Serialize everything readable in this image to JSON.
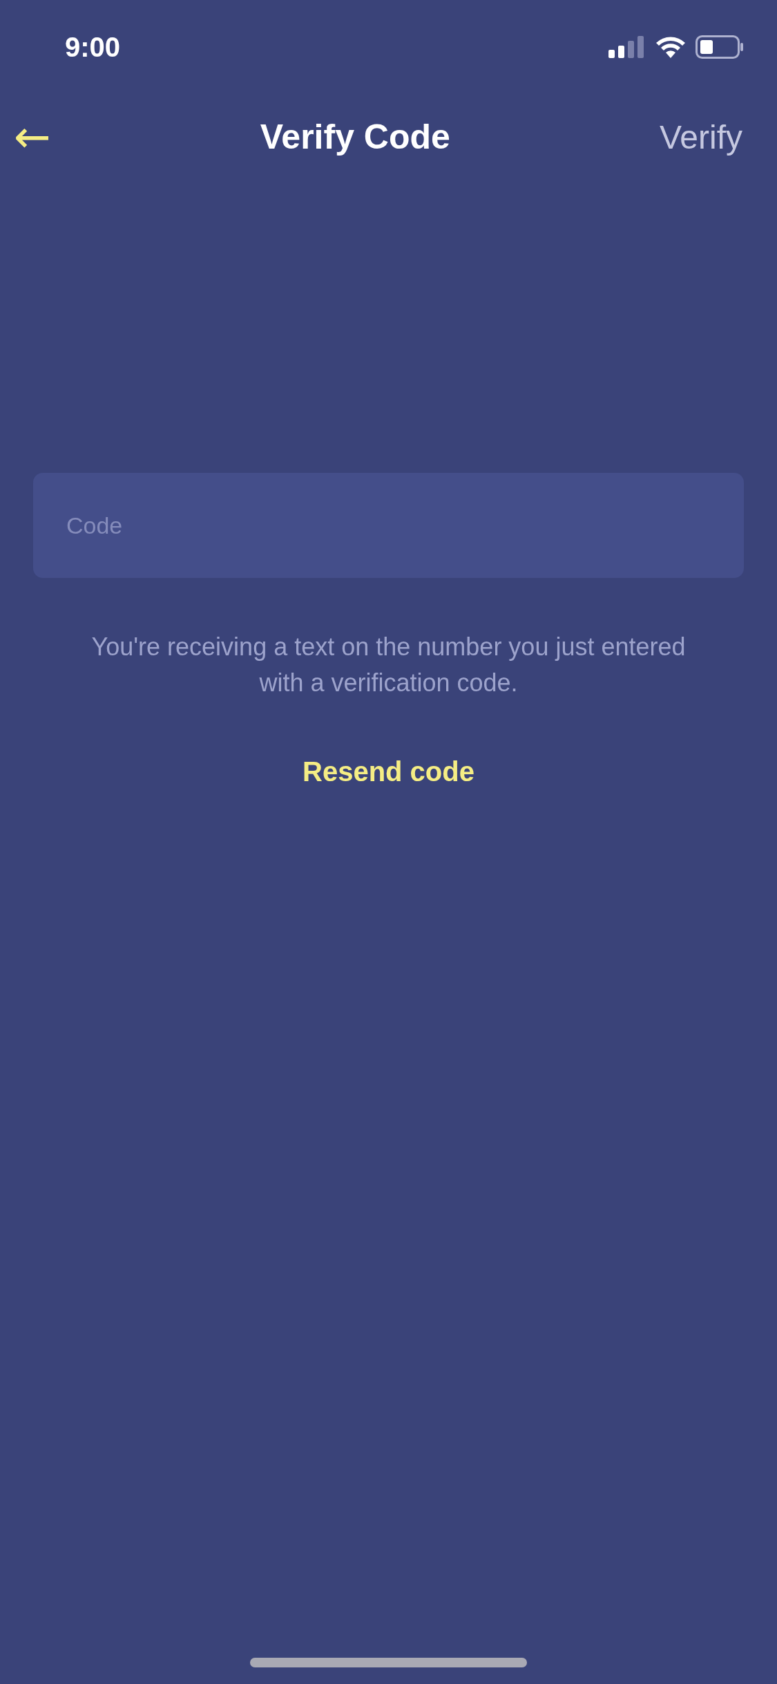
{
  "status_bar": {
    "time": "9:00"
  },
  "nav_bar": {
    "back": "←",
    "title": "Verify Code",
    "action": {
      "label": "Verify",
      "disabled": true
    }
  },
  "code_field": {
    "placeholder": "Code"
  },
  "message": "You're receiving a text on the number you just entered with a verification code.",
  "resend_link": "Resend code"
}
